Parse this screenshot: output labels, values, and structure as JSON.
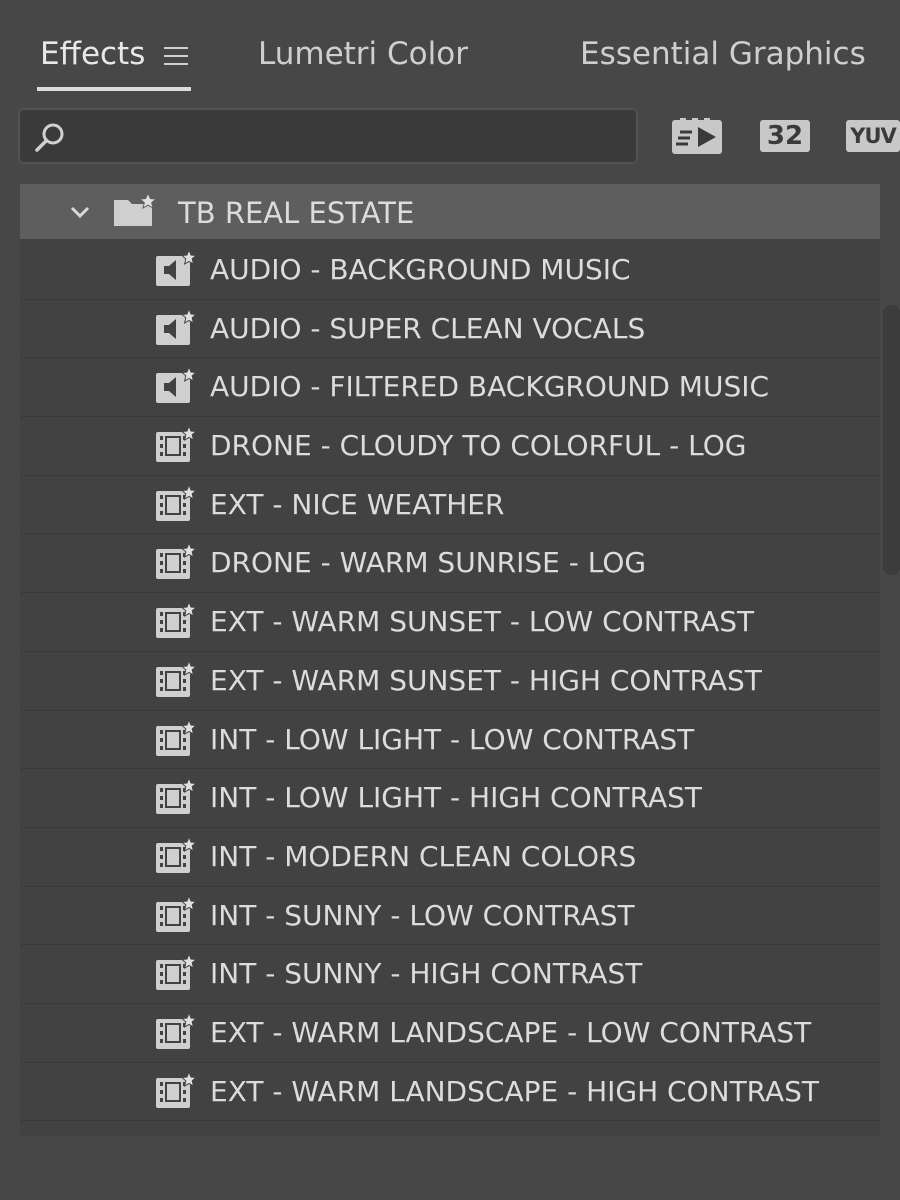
{
  "tabs": [
    {
      "label": "Effects",
      "active": true
    },
    {
      "label": "Lumetri Color",
      "active": false
    },
    {
      "label": "Essential Graphics",
      "active": false
    }
  ],
  "search": {
    "value": "",
    "placeholder": ""
  },
  "toolbar": {
    "accelerated_icon": "accelerated-effects-icon",
    "bit32_label": "32",
    "yuv_label": "YUV"
  },
  "tree": {
    "folder": {
      "label": "TB REAL ESTATE",
      "expanded": true
    },
    "items": [
      {
        "label": "AUDIO - BACKGROUND MUSIC",
        "type": "audio"
      },
      {
        "label": "AUDIO - SUPER CLEAN VOCALS",
        "type": "audio"
      },
      {
        "label": "AUDIO - FILTERED BACKGROUND MUSIC",
        "type": "audio"
      },
      {
        "label": "DRONE - CLOUDY TO COLORFUL - LOG",
        "type": "video"
      },
      {
        "label": "EXT - NICE WEATHER",
        "type": "video"
      },
      {
        "label": "DRONE - WARM SUNRISE - LOG",
        "type": "video"
      },
      {
        "label": "EXT - WARM SUNSET - LOW CONTRAST",
        "type": "video"
      },
      {
        "label": "EXT - WARM SUNSET - HIGH CONTRAST",
        "type": "video"
      },
      {
        "label": "INT - LOW LIGHT - LOW CONTRAST",
        "type": "video"
      },
      {
        "label": "INT - LOW LIGHT - HIGH CONTRAST",
        "type": "video"
      },
      {
        "label": "INT - MODERN CLEAN COLORS",
        "type": "video"
      },
      {
        "label": "INT - SUNNY - LOW CONTRAST",
        "type": "video"
      },
      {
        "label": "INT - SUNNY - HIGH CONTRAST",
        "type": "video"
      },
      {
        "label": "EXT - WARM LANDSCAPE - LOW CONTRAST",
        "type": "video"
      },
      {
        "label": "EXT - WARM LANDSCAPE - HIGH CONTRAST",
        "type": "video"
      }
    ]
  }
}
